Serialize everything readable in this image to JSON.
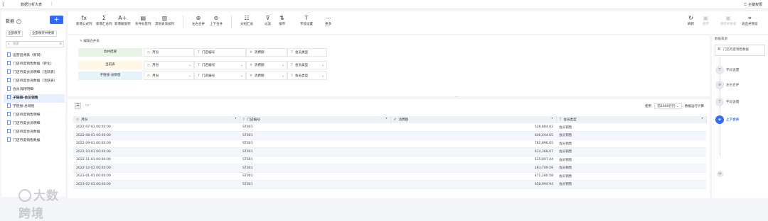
{
  "app": {
    "title": "数据分析大表",
    "share_label": "主键权限"
  },
  "left": {
    "header": "数据",
    "add_label": "+",
    "btn_save": "全部保存",
    "btn_save_update": "全部保存并更新",
    "search_placeholder": "搜索",
    "items": [
      {
        "label": "运营追溯表（新同）"
      },
      {
        "label": "门店月度销售数据（转化）"
      },
      {
        "label": "门店月度会员明细（活跃表）"
      },
      {
        "label": "门店月度会员数据（活跃表）"
      },
      {
        "label": "会员消耗明细-"
      },
      {
        "label": "子链接-会员销售"
      },
      {
        "label": "子链接-总销售"
      },
      {
        "label": "门店月度销售明细"
      },
      {
        "label": "门店月度会员明细"
      },
      {
        "label": "门店月度会员数据"
      },
      {
        "label": "门店月度销售数据"
      }
    ],
    "logo_text": "大数跨境"
  },
  "toolbar": {
    "items": [
      {
        "glyph": "fx",
        "label": "新增公式列"
      },
      {
        "glyph": "Σ",
        "label": "新增汇总列"
      },
      {
        "glyph": "A+",
        "label": "新增赋值列"
      },
      {
        "glyph": "▤",
        "label": "条件标签列"
      },
      {
        "glyph": "▥",
        "label": "其他表添加列"
      },
      {
        "glyph": "⊕",
        "label": "左右合并"
      },
      {
        "glyph": "⊜",
        "label": "上下合并"
      },
      {
        "glyph": "☷",
        "label": "分组汇总"
      },
      {
        "glyph": "⊽",
        "label": "过滤"
      },
      {
        "glyph": "⇅",
        "label": "排序"
      },
      {
        "glyph": "T",
        "label": "字段设置"
      },
      {
        "glyph": "⋯",
        "label": "更多"
      }
    ],
    "right": [
      {
        "glyph": "↻",
        "label": "刷新",
        "disabled": false
      },
      {
        "glyph": "▣",
        "label": "保存",
        "disabled": true
      },
      {
        "glyph": "▣",
        "label": "保存并更新",
        "disabled": true
      },
      {
        "glyph": "⌗",
        "label": "退出并预览",
        "disabled": false
      }
    ]
  },
  "merge": {
    "hint": "编辑合并表",
    "rows": [
      {
        "label": "合并结果",
        "f1": "月份",
        "f2": "门店编号",
        "f3": "消费额",
        "f4": "会员类型",
        "header": true
      },
      {
        "label": "当前表",
        "f1": "月份",
        "f2": "门店编号",
        "f3": "消费额",
        "f4": "会员类型",
        "header": false
      },
      {
        "label": "子链接-总销售",
        "f1": "月份",
        "f2": "门店编号",
        "f3": "消费额",
        "f4": "会员类型",
        "header": false
      }
    ]
  },
  "table": {
    "use_label": "使用",
    "rows_select": "前1000行行",
    "run_label": "数据运行计算",
    "columns": [
      "月份",
      "门店编号",
      "消费额",
      "会员类型"
    ],
    "rows": [
      [
        "2022-07-01 00:00:00",
        "ST001",
        "528,884.02",
        "会员销售"
      ],
      [
        "2022-08-01 00:00:00",
        "ST001",
        "646,404.65",
        "会员销售"
      ],
      [
        "2022-09-01 00:00:00",
        "ST001",
        "761,896.05",
        "会员销售"
      ],
      [
        "2022-10-01 00:00:00",
        "ST001",
        "614,368.07",
        "会员销售"
      ],
      [
        "2022-11-01 00:00:00",
        "ST001",
        "515,897.44",
        "会员销售"
      ],
      [
        "2022-12-01 00:00:00",
        "ST001",
        "263,709.59",
        "会员销售"
      ],
      [
        "2023-01-01 00:00:00",
        "ST001",
        "471,280.58",
        "会员销售"
      ],
      [
        "2023-02-01 00:00:00",
        "ST001",
        "658,994.94",
        "会员销售"
      ]
    ]
  },
  "right": {
    "title": "数据来源",
    "source": "门店月度销售数据",
    "steps": [
      {
        "label": "字段设置",
        "glyph": "T"
      },
      {
        "label": "左右合并",
        "glyph": "⊕"
      },
      {
        "label": "字段设置",
        "glyph": "T"
      },
      {
        "label": "上下合并",
        "glyph": "⊜"
      }
    ]
  }
}
